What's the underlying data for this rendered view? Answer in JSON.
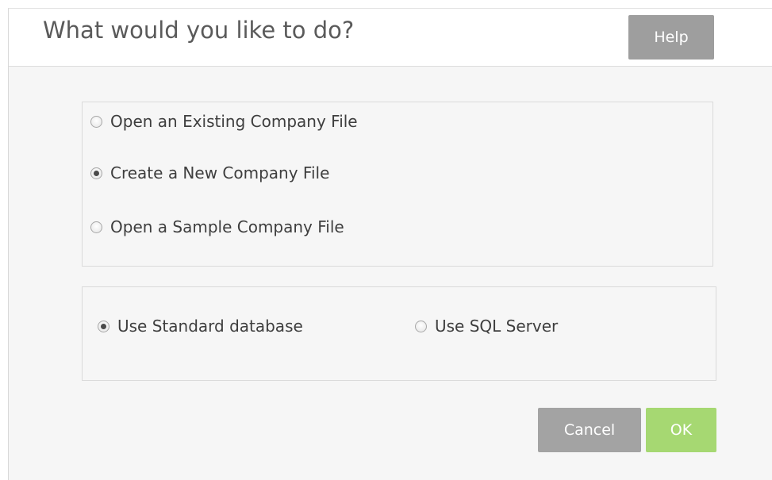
{
  "dialog": {
    "title": "What would you like to do?",
    "help_label": "Help"
  },
  "file_options": [
    {
      "label": "Open an Existing Company File",
      "selected": false
    },
    {
      "label": "Create a New Company File",
      "selected": true
    },
    {
      "label": "Open a Sample Company File",
      "selected": false
    }
  ],
  "database_options": [
    {
      "label": "Use Standard database",
      "selected": true
    },
    {
      "label": "Use SQL Server",
      "selected": false
    }
  ],
  "actions": {
    "cancel_label": "Cancel",
    "ok_label": "OK"
  },
  "colors": {
    "help_button": "#9e9e9e",
    "cancel_button": "#a3a3a3",
    "ok_button": "#a6d872"
  }
}
